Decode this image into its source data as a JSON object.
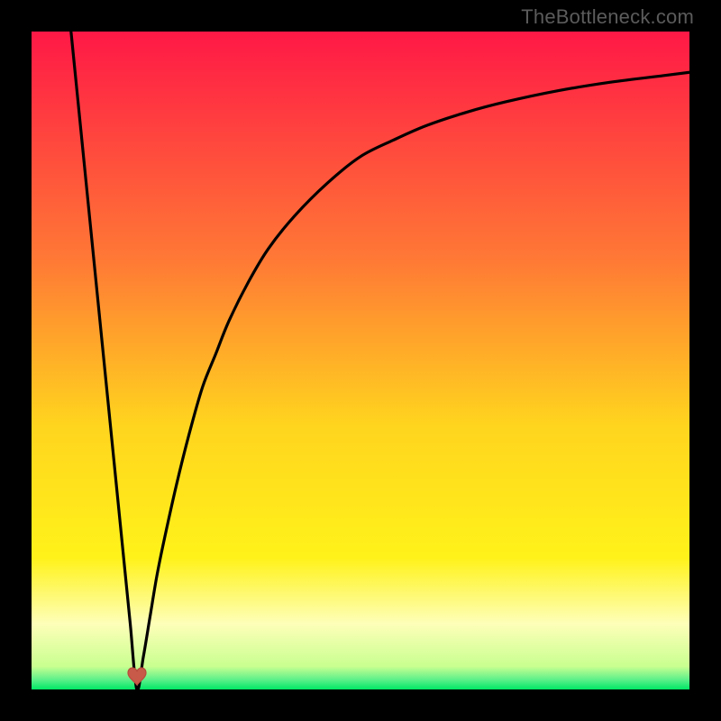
{
  "watermark": "TheBottleneck.com",
  "colors": {
    "frame": "#000000",
    "top": "#ff1846",
    "mid": "#ffa030",
    "yellow": "#fff21a",
    "pale": "#feffb9",
    "green": "#00e865",
    "curve": "#000000",
    "marker_fill": "#c85a4a",
    "marker_stroke": "#b94b3c"
  },
  "chart_data": {
    "type": "line",
    "title": "",
    "xlabel": "",
    "ylabel": "",
    "xlim": [
      0,
      100
    ],
    "ylim": [
      0,
      100
    ],
    "notch": {
      "x": 16,
      "y": 0
    },
    "series": [
      {
        "name": "curve",
        "x": [
          6,
          7,
          8,
          9,
          10,
          11,
          12,
          13,
          14,
          15,
          16,
          17,
          18,
          19,
          20,
          22,
          24,
          26,
          28,
          30,
          33,
          36,
          40,
          45,
          50,
          55,
          60,
          66,
          72,
          80,
          88,
          96,
          100
        ],
        "values": [
          100,
          90,
          80,
          70,
          60,
          50,
          40,
          30,
          20,
          10,
          0,
          5,
          11,
          17,
          22,
          31,
          39,
          46,
          51,
          56,
          62,
          67,
          72,
          77,
          81,
          83.5,
          85.7,
          87.7,
          89.3,
          91,
          92.3,
          93.3,
          93.8
        ]
      }
    ],
    "marker": {
      "x": 16,
      "y": 2,
      "shape": "heart"
    },
    "gradient_stops": [
      {
        "pos": 0.0,
        "color": "#ff1846"
      },
      {
        "pos": 0.35,
        "color": "#ff7a35"
      },
      {
        "pos": 0.6,
        "color": "#ffd51e"
      },
      {
        "pos": 0.8,
        "color": "#fff21a"
      },
      {
        "pos": 0.9,
        "color": "#feffb9"
      },
      {
        "pos": 0.965,
        "color": "#c9ff90"
      },
      {
        "pos": 0.985,
        "color": "#5df08a"
      },
      {
        "pos": 1.0,
        "color": "#00e865"
      }
    ]
  }
}
